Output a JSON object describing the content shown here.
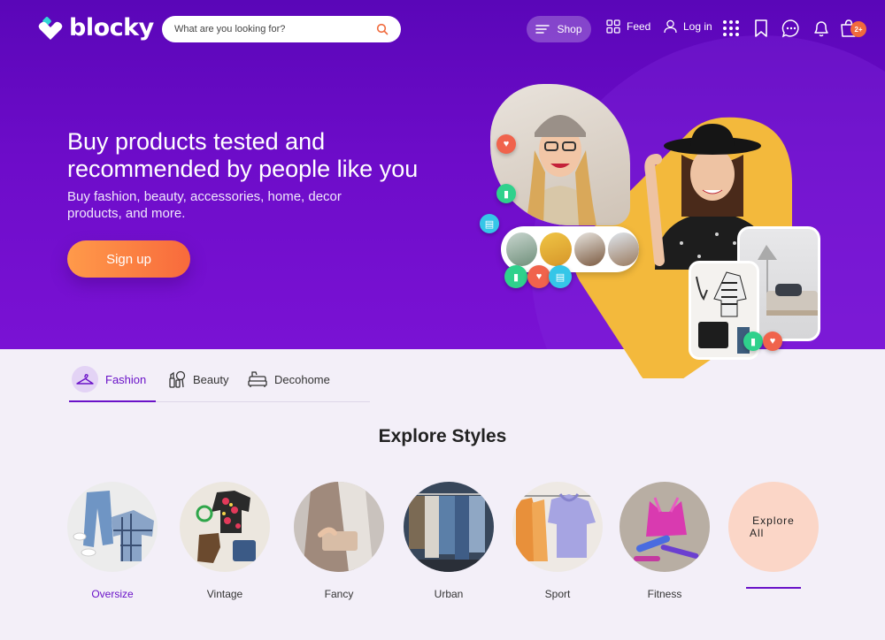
{
  "brand": {
    "name": "blocky"
  },
  "search": {
    "placeholder": "What are you looking for?"
  },
  "nav": {
    "shop_label": "Shop",
    "feed_label": "Feed",
    "login_label": "Log in",
    "cart_badge": "2+",
    "icons": [
      "apps-grid-icon",
      "bookmark-icon",
      "chat-icon",
      "bell-icon",
      "cart-icon"
    ]
  },
  "hero": {
    "title": "Buy products tested and recommended by people like you",
    "subtitle": "Buy fashion, beauty, accessories, home, decor products, and more.",
    "cta_label": "Sign up"
  },
  "tabs": [
    {
      "label": "Fashion",
      "icon": "hanger-icon",
      "active": true
    },
    {
      "label": "Beauty",
      "icon": "beauty-icon",
      "active": false
    },
    {
      "label": "Decohome",
      "icon": "sofa-icon",
      "active": false
    }
  ],
  "explore": {
    "title": "Explore Styles",
    "styles": [
      {
        "label": "Oversize",
        "active": true
      },
      {
        "label": "Vintage",
        "active": false
      },
      {
        "label": "Fancy",
        "active": false
      },
      {
        "label": "Urban",
        "active": false
      },
      {
        "label": "Sport",
        "active": false
      },
      {
        "label": "Fitness",
        "active": false
      }
    ],
    "all_line1": "Explore",
    "all_line2": "All"
  },
  "colors": {
    "brand_purple": "#6a12c8",
    "hero_gradient_top": "#5a06b8",
    "cta_orange": "#f86a3c",
    "yellow_shape": "#f3b93c",
    "page_bg": "#f3eff8"
  }
}
